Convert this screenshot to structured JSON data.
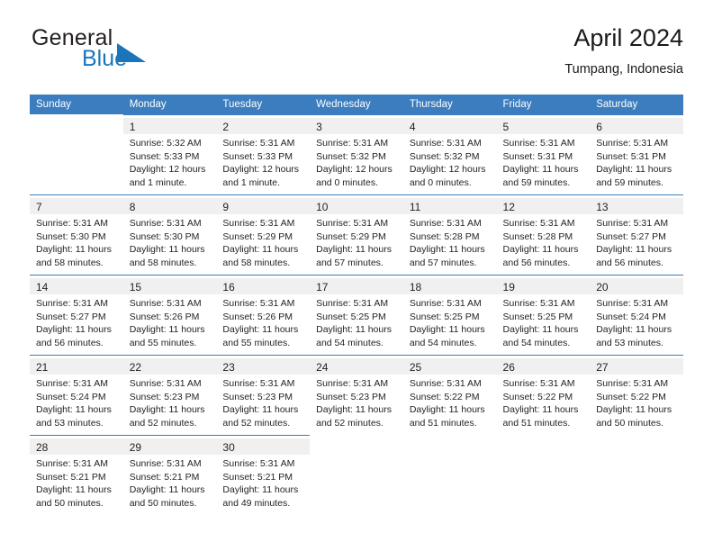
{
  "brand": {
    "name_top": "General",
    "name_bottom": "Blue",
    "triangle_color": "#1b75bb",
    "top_color": "#231f20",
    "bottom_color": "#1b75bb"
  },
  "header": {
    "title": "April 2024",
    "location": "Tumpang, Indonesia"
  },
  "theme": {
    "header_bg": "#3b7dbf",
    "header_text": "#ffffff",
    "daynum_band_bg": "#f0f0f0",
    "grid_rule": "#3b7dbf",
    "text": "#231f20"
  },
  "weekdays": [
    "Sunday",
    "Monday",
    "Tuesday",
    "Wednesday",
    "Thursday",
    "Friday",
    "Saturday"
  ],
  "weeks": [
    [
      {
        "day": "",
        "lines": []
      },
      {
        "day": "1",
        "lines": [
          "Sunrise: 5:32 AM",
          "Sunset: 5:33 PM",
          "Daylight: 12 hours",
          "and 1 minute."
        ]
      },
      {
        "day": "2",
        "lines": [
          "Sunrise: 5:31 AM",
          "Sunset: 5:33 PM",
          "Daylight: 12 hours",
          "and 1 minute."
        ]
      },
      {
        "day": "3",
        "lines": [
          "Sunrise: 5:31 AM",
          "Sunset: 5:32 PM",
          "Daylight: 12 hours",
          "and 0 minutes."
        ]
      },
      {
        "day": "4",
        "lines": [
          "Sunrise: 5:31 AM",
          "Sunset: 5:32 PM",
          "Daylight: 12 hours",
          "and 0 minutes."
        ]
      },
      {
        "day": "5",
        "lines": [
          "Sunrise: 5:31 AM",
          "Sunset: 5:31 PM",
          "Daylight: 11 hours",
          "and 59 minutes."
        ]
      },
      {
        "day": "6",
        "lines": [
          "Sunrise: 5:31 AM",
          "Sunset: 5:31 PM",
          "Daylight: 11 hours",
          "and 59 minutes."
        ]
      }
    ],
    [
      {
        "day": "7",
        "lines": [
          "Sunrise: 5:31 AM",
          "Sunset: 5:30 PM",
          "Daylight: 11 hours",
          "and 58 minutes."
        ]
      },
      {
        "day": "8",
        "lines": [
          "Sunrise: 5:31 AM",
          "Sunset: 5:30 PM",
          "Daylight: 11 hours",
          "and 58 minutes."
        ]
      },
      {
        "day": "9",
        "lines": [
          "Sunrise: 5:31 AM",
          "Sunset: 5:29 PM",
          "Daylight: 11 hours",
          "and 58 minutes."
        ]
      },
      {
        "day": "10",
        "lines": [
          "Sunrise: 5:31 AM",
          "Sunset: 5:29 PM",
          "Daylight: 11 hours",
          "and 57 minutes."
        ]
      },
      {
        "day": "11",
        "lines": [
          "Sunrise: 5:31 AM",
          "Sunset: 5:28 PM",
          "Daylight: 11 hours",
          "and 57 minutes."
        ]
      },
      {
        "day": "12",
        "lines": [
          "Sunrise: 5:31 AM",
          "Sunset: 5:28 PM",
          "Daylight: 11 hours",
          "and 56 minutes."
        ]
      },
      {
        "day": "13",
        "lines": [
          "Sunrise: 5:31 AM",
          "Sunset: 5:27 PM",
          "Daylight: 11 hours",
          "and 56 minutes."
        ]
      }
    ],
    [
      {
        "day": "14",
        "lines": [
          "Sunrise: 5:31 AM",
          "Sunset: 5:27 PM",
          "Daylight: 11 hours",
          "and 56 minutes."
        ]
      },
      {
        "day": "15",
        "lines": [
          "Sunrise: 5:31 AM",
          "Sunset: 5:26 PM",
          "Daylight: 11 hours",
          "and 55 minutes."
        ]
      },
      {
        "day": "16",
        "lines": [
          "Sunrise: 5:31 AM",
          "Sunset: 5:26 PM",
          "Daylight: 11 hours",
          "and 55 minutes."
        ]
      },
      {
        "day": "17",
        "lines": [
          "Sunrise: 5:31 AM",
          "Sunset: 5:25 PM",
          "Daylight: 11 hours",
          "and 54 minutes."
        ]
      },
      {
        "day": "18",
        "lines": [
          "Sunrise: 5:31 AM",
          "Sunset: 5:25 PM",
          "Daylight: 11 hours",
          "and 54 minutes."
        ]
      },
      {
        "day": "19",
        "lines": [
          "Sunrise: 5:31 AM",
          "Sunset: 5:25 PM",
          "Daylight: 11 hours",
          "and 54 minutes."
        ]
      },
      {
        "day": "20",
        "lines": [
          "Sunrise: 5:31 AM",
          "Sunset: 5:24 PM",
          "Daylight: 11 hours",
          "and 53 minutes."
        ]
      }
    ],
    [
      {
        "day": "21",
        "lines": [
          "Sunrise: 5:31 AM",
          "Sunset: 5:24 PM",
          "Daylight: 11 hours",
          "and 53 minutes."
        ]
      },
      {
        "day": "22",
        "lines": [
          "Sunrise: 5:31 AM",
          "Sunset: 5:23 PM",
          "Daylight: 11 hours",
          "and 52 minutes."
        ]
      },
      {
        "day": "23",
        "lines": [
          "Sunrise: 5:31 AM",
          "Sunset: 5:23 PM",
          "Daylight: 11 hours",
          "and 52 minutes."
        ]
      },
      {
        "day": "24",
        "lines": [
          "Sunrise: 5:31 AM",
          "Sunset: 5:23 PM",
          "Daylight: 11 hours",
          "and 52 minutes."
        ]
      },
      {
        "day": "25",
        "lines": [
          "Sunrise: 5:31 AM",
          "Sunset: 5:22 PM",
          "Daylight: 11 hours",
          "and 51 minutes."
        ]
      },
      {
        "day": "26",
        "lines": [
          "Sunrise: 5:31 AM",
          "Sunset: 5:22 PM",
          "Daylight: 11 hours",
          "and 51 minutes."
        ]
      },
      {
        "day": "27",
        "lines": [
          "Sunrise: 5:31 AM",
          "Sunset: 5:22 PM",
          "Daylight: 11 hours",
          "and 50 minutes."
        ]
      }
    ],
    [
      {
        "day": "28",
        "lines": [
          "Sunrise: 5:31 AM",
          "Sunset: 5:21 PM",
          "Daylight: 11 hours",
          "and 50 minutes."
        ]
      },
      {
        "day": "29",
        "lines": [
          "Sunrise: 5:31 AM",
          "Sunset: 5:21 PM",
          "Daylight: 11 hours",
          "and 50 minutes."
        ]
      },
      {
        "day": "30",
        "lines": [
          "Sunrise: 5:31 AM",
          "Sunset: 5:21 PM",
          "Daylight: 11 hours",
          "and 49 minutes."
        ]
      },
      {
        "day": "",
        "lines": []
      },
      {
        "day": "",
        "lines": []
      },
      {
        "day": "",
        "lines": []
      },
      {
        "day": "",
        "lines": []
      }
    ]
  ]
}
